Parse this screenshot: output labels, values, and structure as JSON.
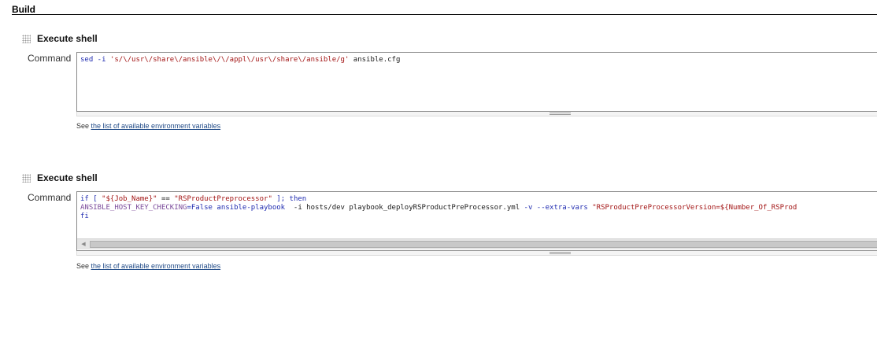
{
  "section": {
    "title": "Build"
  },
  "steps": [
    {
      "title": "Execute shell",
      "field_label": "Command",
      "command_lines": [
        [
          {
            "t": "sed -i ",
            "c": "kw"
          },
          {
            "t": "'s/\\/usr\\/share\\/ansible\\/\\/appl\\/usr\\/share\\/ansible/g'",
            "c": "str"
          },
          {
            "t": " ansible.cfg",
            "c": "plain"
          }
        ]
      ],
      "help_prefix": "See ",
      "help_link": "the list of available environment variables"
    },
    {
      "title": "Execute shell",
      "field_label": "Command",
      "command_lines": [
        [
          {
            "t": "if [ ",
            "c": "kw"
          },
          {
            "t": "\"${Job_Name}\"",
            "c": "str"
          },
          {
            "t": " == ",
            "c": "plain"
          },
          {
            "t": "\"RSProductPreprocessor\"",
            "c": "str"
          },
          {
            "t": " ]; then",
            "c": "kw"
          }
        ],
        [
          {
            "t": "ANSIBLE_HOST_KEY_CHECKING",
            "c": "var"
          },
          {
            "t": "=False ansible-playbook",
            "c": "kw"
          },
          {
            "t": "  -i hosts/dev playbook_deployRSProductPreProcessor.yml ",
            "c": "plain"
          },
          {
            "t": "-v --extra-vars ",
            "c": "kw"
          },
          {
            "t": "\"RSProductPreProcessorVersion=${Number_Of_RSProd",
            "c": "str"
          }
        ],
        [
          {
            "t": "fi",
            "c": "kw"
          }
        ]
      ],
      "scroll_left_icon": "left-arrow-icon",
      "help_prefix": "See ",
      "help_link": "the list of available environment variables"
    }
  ]
}
